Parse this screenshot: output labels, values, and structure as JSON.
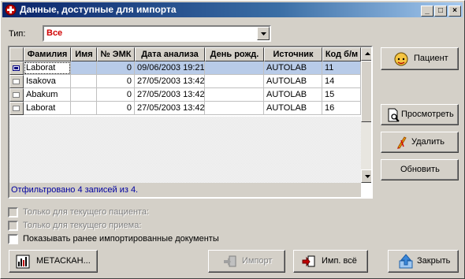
{
  "window": {
    "title": "Данные, доступные для импорта",
    "min_glyph": "_",
    "max_glyph": "□",
    "close_glyph": "×"
  },
  "filter": {
    "label": "Тип:",
    "value": "Все"
  },
  "grid": {
    "columns": [
      "Фамилия",
      "Имя",
      "№ ЭМК",
      "Дата анализа",
      "День рожд.",
      "Источник",
      "Код б/м"
    ],
    "rows": [
      {
        "surname": "Laborat",
        "name": "",
        "emk": "0",
        "date": "09/06/2003 19:21:",
        "birthday": "",
        "source": "AUTOLAB",
        "code": "11",
        "selected": true
      },
      {
        "surname": "Isakova",
        "name": "",
        "emk": "0",
        "date": "27/05/2003 13:42:",
        "birthday": "",
        "source": "AUTOLAB",
        "code": "14",
        "selected": false
      },
      {
        "surname": "Abakum",
        "name": "",
        "emk": "0",
        "date": "27/05/2003 13:42:",
        "birthday": "",
        "source": "AUTOLAB",
        "code": "15",
        "selected": false
      },
      {
        "surname": "Laborat",
        "name": "",
        "emk": "0",
        "date": "27/05/2003 13:42:",
        "birthday": "",
        "source": "AUTOLAB",
        "code": "16",
        "selected": false
      }
    ],
    "footer": "Отфильтровано 4 записей из 4."
  },
  "side_buttons": {
    "patient": "Пациент",
    "view": "Просмотреть",
    "delete": "Удалить",
    "refresh": "Обновить"
  },
  "checkboxes": [
    {
      "label": "Только для текущего пациента:",
      "checked": false,
      "enabled": false
    },
    {
      "label": "Только для текущего приема:",
      "checked": false,
      "enabled": false
    },
    {
      "label": "Показывать ранее импортированные документы",
      "checked": false,
      "enabled": true
    }
  ],
  "bottom_buttons": {
    "metascan": "МЕТАСКАН...",
    "import": "Импорт",
    "import_all": "Имп. всё",
    "close": "Закрыть"
  },
  "colors": {
    "title_start": "#0a246a",
    "title_end": "#a6caf0",
    "filter_value": "#d00000",
    "footer_text": "#0000a0",
    "selected_row": "#b8cbe8"
  }
}
